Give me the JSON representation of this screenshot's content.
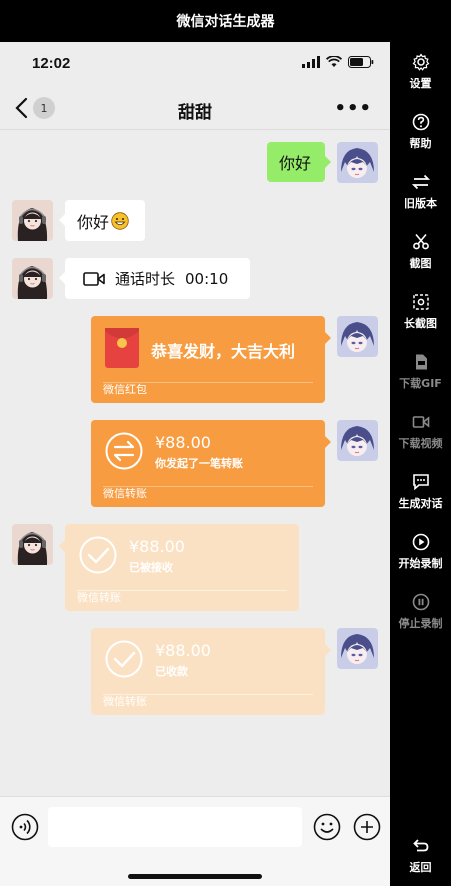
{
  "app_title": "微信对话生成器",
  "status_bar": {
    "time": "12:02"
  },
  "nav": {
    "back_badge": "1",
    "title": "甜甜",
    "more": "•••"
  },
  "messages": [
    {
      "side": "right",
      "type": "text",
      "text": "你好"
    },
    {
      "side": "left",
      "type": "text",
      "text": "你好",
      "emoji": "grinning-face-emoji"
    },
    {
      "side": "left",
      "type": "call",
      "label": "通话时长",
      "duration": "00:10"
    },
    {
      "side": "right",
      "type": "red_packet",
      "text": "恭喜发财，大吉大利",
      "footer": "微信红包"
    },
    {
      "side": "right",
      "type": "transfer",
      "amount": "¥88.00",
      "note": "你发起了一笔转账",
      "footer": "微信转账"
    },
    {
      "side": "left",
      "type": "transfer_received",
      "amount": "¥88.00",
      "note": "已被接收",
      "footer": "微信转账"
    },
    {
      "side": "right",
      "type": "transfer_received",
      "amount": "¥88.00",
      "note": "已收款",
      "footer": "微信转账"
    }
  ],
  "sidebar": {
    "settings": "设置",
    "help": "帮助",
    "old_version": "旧版本",
    "screenshot": "截图",
    "long_screenshot": "长截图",
    "download_gif": "下载GIF",
    "download_video": "下载视频",
    "generate_dialog": "生成对话",
    "start_record": "开始录制",
    "stop_record": "停止录制",
    "back": "返回"
  },
  "colors": {
    "green_bubble": "#95ec69",
    "orange_card": "#f79c41",
    "pale_card": "#fbe1c3",
    "chat_bg": "#ededed"
  }
}
